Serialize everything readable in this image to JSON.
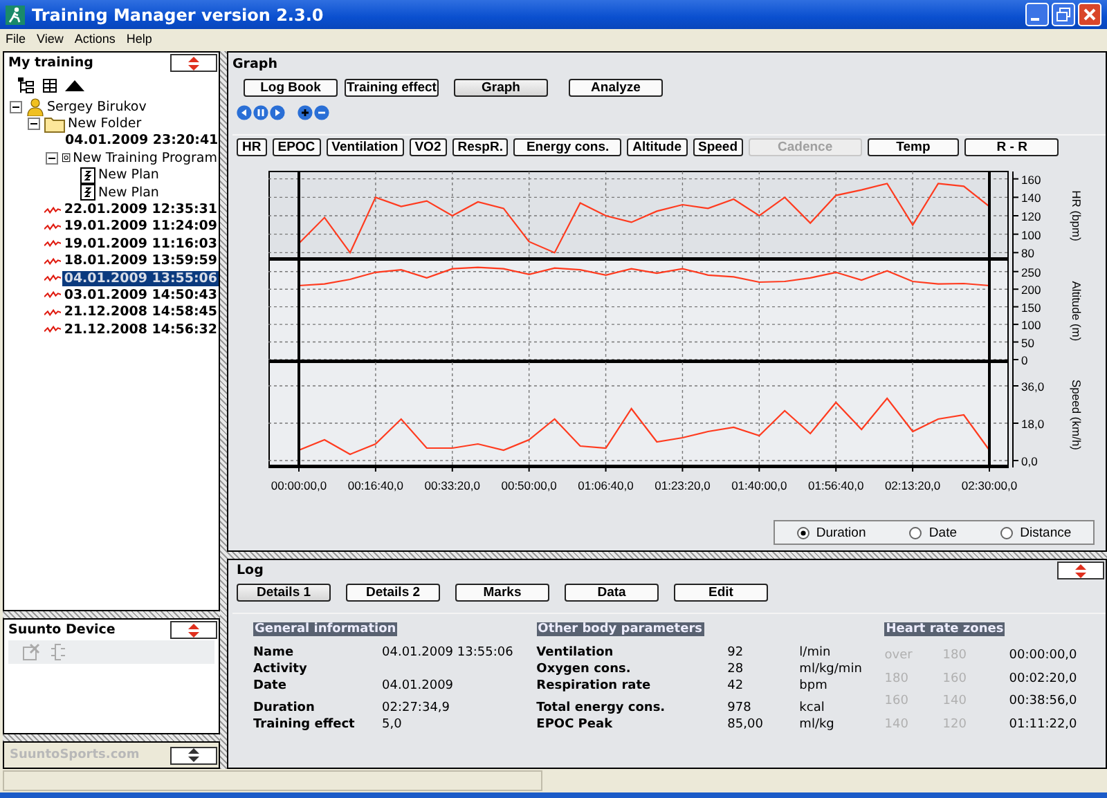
{
  "window": {
    "title": "Training Manager version 2.3.0"
  },
  "menu": [
    "File",
    "View",
    "Actions",
    "Help"
  ],
  "tree_panel": {
    "title": "My training",
    "items": [
      {
        "label": "Sergey Birukov",
        "kind": "person",
        "expanded": true,
        "selected": false,
        "children": [
          {
            "label": "New Folder",
            "kind": "folder",
            "expanded": true,
            "selected": false,
            "children": [
              {
                "label": "04.01.2009 23:20:41",
                "kind": "workout",
                "selected": false
              },
              {
                "label": "New Training Program",
                "kind": "program",
                "expanded": true,
                "selected": false,
                "children": [
                  {
                    "label": "New Plan",
                    "kind": "plan",
                    "selected": false
                  },
                  {
                    "label": "New Plan",
                    "kind": "plan",
                    "selected": false
                  }
                ]
              }
            ]
          },
          {
            "label": "22.01.2009 12:35:31",
            "kind": "workout",
            "selected": false
          },
          {
            "label": "19.01.2009 11:24:09",
            "kind": "workout",
            "selected": false
          },
          {
            "label": "19.01.2009 11:16:03",
            "kind": "workout",
            "selected": false
          },
          {
            "label": "18.01.2009 13:59:59",
            "kind": "workout",
            "selected": false
          },
          {
            "label": "04.01.2009 13:55:06",
            "kind": "workout",
            "selected": true
          },
          {
            "label": "03.01.2009 14:50:43",
            "kind": "workout",
            "selected": false
          },
          {
            "label": "21.12.2008 14:58:45",
            "kind": "workout",
            "selected": false
          },
          {
            "label": "21.12.2008 14:56:32",
            "kind": "workout",
            "selected": false
          }
        ]
      }
    ]
  },
  "device_panel": {
    "title": "Suunto Device"
  },
  "sports_link": {
    "label": "SuuntoSports.com"
  },
  "graph_panel": {
    "title": "Graph",
    "views": [
      {
        "label": "Log Book",
        "selected": false
      },
      {
        "label": "Training effect",
        "selected": false
      },
      {
        "label": "Graph",
        "selected": true
      },
      {
        "label": "Analyze",
        "selected": false
      }
    ],
    "channels": [
      {
        "label": "HR",
        "disabled": false
      },
      {
        "label": "EPOC",
        "disabled": false
      },
      {
        "label": "Ventilation",
        "disabled": false
      },
      {
        "label": "VO2",
        "disabled": false
      },
      {
        "label": "RespR.",
        "disabled": false
      },
      {
        "label": "Energy cons.",
        "disabled": false
      },
      {
        "label": "Altitude",
        "disabled": false
      },
      {
        "label": "Speed",
        "disabled": false
      },
      {
        "label": "Cadence",
        "disabled": true
      },
      {
        "label": "Temp",
        "disabled": false
      },
      {
        "label": "R - R",
        "disabled": false
      }
    ],
    "charts": [
      {
        "chart_data": {
          "type": "line",
          "ylabel": "HR (bpm)",
          "grid": true,
          "categories": [
            null,
            null,
            null,
            null,
            null,
            null,
            null,
            null,
            null,
            null,
            null,
            null,
            null,
            null,
            null,
            null,
            null,
            null,
            null,
            null,
            null,
            null,
            null,
            null,
            null,
            null,
            null,
            null
          ],
          "ylim": [
            75,
            165
          ],
          "yticks": [
            80,
            100,
            120,
            140,
            160
          ],
          "series": [
            {
              "color": "#ff3b1f",
              "values": [
                90,
                118,
                80,
                140,
                130,
                136,
                120,
                135,
                128,
                92,
                80,
                134,
                120,
                113,
                125,
                132,
                128,
                138,
                120,
                140,
                112,
                142,
                148,
                155,
                110,
                155,
                152,
                130
              ]
            }
          ]
        }
      },
      {
        "chart_data": {
          "type": "line",
          "ylabel": "Altitude (m)",
          "grid": true,
          "categories": [
            null,
            null,
            null,
            null,
            null,
            null,
            null,
            null,
            null,
            null,
            null,
            null,
            null,
            null,
            null,
            null,
            null,
            null,
            null,
            null,
            null,
            null,
            null,
            null,
            null,
            null,
            null,
            null
          ],
          "ylim": [
            0,
            275
          ],
          "yticks": [
            0,
            50,
            100,
            150,
            200,
            250
          ],
          "series": [
            {
              "color": "#ff3b1f",
              "values": [
                210,
                215,
                228,
                248,
                255,
                232,
                258,
                262,
                258,
                242,
                260,
                255,
                240,
                258,
                245,
                258,
                240,
                235,
                220,
                222,
                232,
                248,
                226,
                252,
                222,
                215,
                216,
                210
              ]
            }
          ]
        }
      },
      {
        "chart_data": {
          "type": "line",
          "ylabel": "Speed (km/h)",
          "grid": true,
          "ylim": [
            -2,
            46
          ],
          "yticks": [
            {
              "value": 0,
              "label": "0,0"
            },
            {
              "value": 18,
              "label": "18,0"
            },
            {
              "value": 36,
              "label": "36,0"
            }
          ],
          "categories": [
            "00:00:00,0",
            null,
            null,
            "00:16:40,0",
            null,
            null,
            "00:33:20,0",
            null,
            null,
            "00:50:00,0",
            null,
            null,
            "01:06:40,0",
            null,
            null,
            "01:23:20,0",
            null,
            null,
            "01:40:00,0",
            null,
            null,
            "01:56:40,0",
            null,
            null,
            "02:13:20,0",
            null,
            null,
            "02:30:00,0"
          ],
          "series": [
            {
              "color": "#ff3b1f",
              "values": [
                5,
                10,
                3,
                8,
                20,
                6,
                6,
                8,
                5,
                10,
                20,
                7,
                6,
                25,
                9,
                11,
                14,
                16,
                12,
                24,
                13,
                28,
                15,
                30,
                14,
                20,
                22,
                5
              ]
            }
          ]
        }
      }
    ],
    "axis_mode": [
      {
        "label": "Duration",
        "selected": true
      },
      {
        "label": "Date",
        "selected": false
      },
      {
        "label": "Distance",
        "selected": false
      }
    ]
  },
  "log_panel": {
    "title": "Log",
    "tabs": [
      {
        "label": "Details 1",
        "selected": true
      },
      {
        "label": "Details 2",
        "selected": false
      },
      {
        "label": "Marks",
        "selected": false
      },
      {
        "label": "Data",
        "selected": false
      },
      {
        "label": "Edit",
        "selected": false
      }
    ],
    "general": {
      "title": "General information",
      "groups": [
        [
          {
            "label": "Name",
            "value": "04.01.2009 13:55:06"
          },
          {
            "label": "Activity"
          },
          {
            "label": "Date",
            "value": "04.01.2009"
          }
        ],
        [
          {
            "label": "Duration",
            "value": "02:27:34,9"
          },
          {
            "label": "Training effect",
            "value": "5,0"
          }
        ]
      ]
    },
    "body": {
      "title": "Other body parameters",
      "groups": [
        [
          {
            "label": "Ventilation",
            "value": "92",
            "unit": "l/min"
          },
          {
            "label": "Oxygen cons.",
            "value": "28",
            "unit": "ml/kg/min"
          },
          {
            "label": "Respiration rate",
            "value": "42",
            "unit": "bpm"
          }
        ],
        [
          {
            "label": "Total energy cons.",
            "value": "978",
            "unit": "kcal"
          },
          {
            "label": "EPOC Peak",
            "value": "85,00",
            "unit": "ml/kg"
          }
        ]
      ]
    },
    "zones": {
      "title": "Heart rate zones",
      "rows": [
        {
          "upper": "over",
          "lower": "180",
          "time": "00:00:00,0"
        },
        {
          "upper": "180",
          "lower": "160",
          "time": "00:02:20,0"
        },
        {
          "upper": "160",
          "lower": "140",
          "time": "00:38:56,0"
        },
        {
          "upper": "140",
          "lower": "120",
          "time": "01:11:22,0"
        }
      ]
    }
  }
}
